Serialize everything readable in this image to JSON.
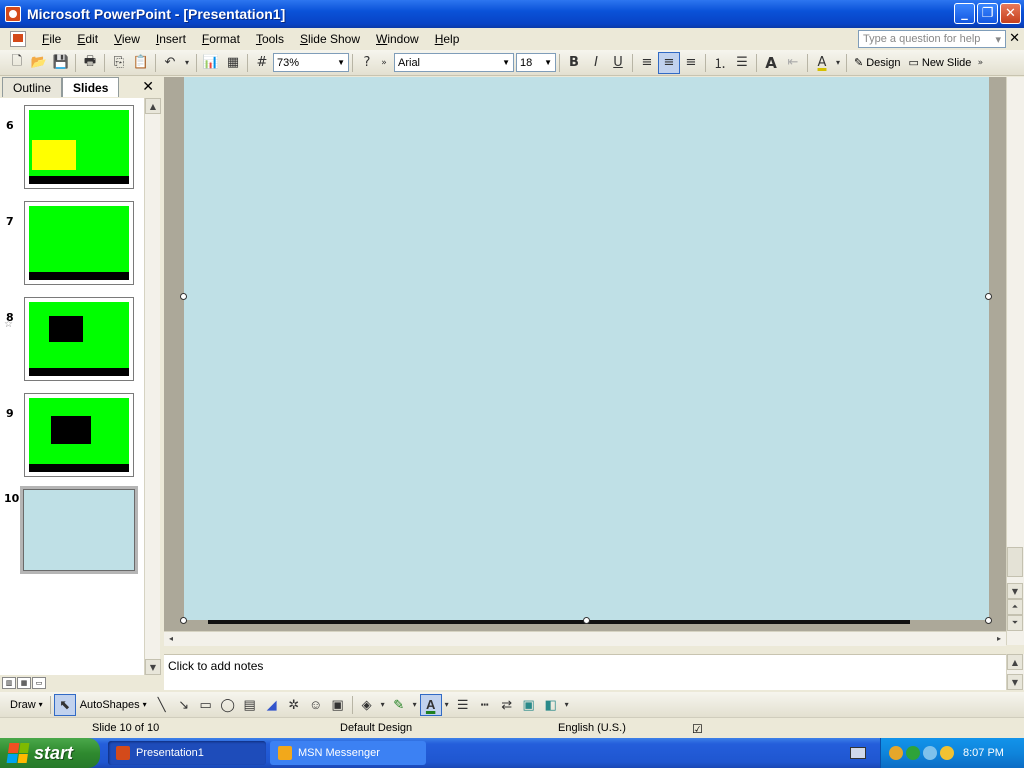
{
  "window": {
    "title": "Microsoft PowerPoint - [Presentation1]",
    "btn_minimize": "_",
    "btn_maximize": "❐",
    "btn_close": "✕"
  },
  "menu": {
    "items": [
      "File",
      "Edit",
      "View",
      "Insert",
      "Format",
      "Tools",
      "Slide Show",
      "Window",
      "Help"
    ],
    "help_placeholder": "Type a question for help",
    "close_glyph": "✕"
  },
  "toolbar": {
    "zoom": "73%",
    "font": "Arial",
    "font_size": "18",
    "bold": "B",
    "italic": "I",
    "underline": "U",
    "design_label": "Design",
    "new_slide_label": "New Slide"
  },
  "panel": {
    "tab_outline": "Outline",
    "tab_slides": "Slides",
    "close_glyph": "✕",
    "thumbnails": [
      {
        "num": "6"
      },
      {
        "num": "7"
      },
      {
        "num": "8"
      },
      {
        "num": "9"
      },
      {
        "num": "10"
      }
    ]
  },
  "notes": {
    "placeholder": "Click to add notes"
  },
  "drawbar": {
    "draw_label": "Draw",
    "autoshapes_label": "AutoShapes"
  },
  "status": {
    "slide_info": "Slide 10 of 10",
    "design": "Default Design",
    "language": "English (U.S.)"
  },
  "taskbar": {
    "start_label": "start",
    "tasks": [
      "Presentation1",
      "MSN Messenger"
    ],
    "clock": "8:07 PM"
  },
  "colors": {
    "slide_background": "#bfe0e6",
    "thumb_green": "#00ff00",
    "highlight_yellow": "#ffff00"
  }
}
